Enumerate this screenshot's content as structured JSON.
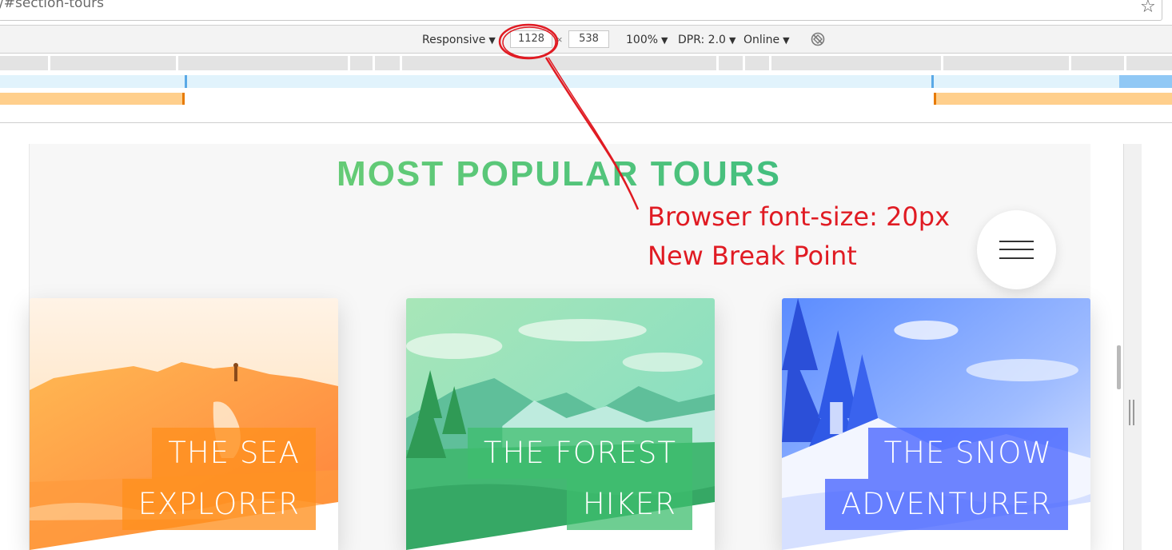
{
  "address_bar": {
    "url_text": "/#section-tours",
    "star_icon": "star-outline-icon"
  },
  "device_toolbar": {
    "device_mode": "Responsive",
    "width": "1128",
    "times": "×",
    "height": "538",
    "zoom": "100%",
    "dpr": "DPR: 2.0",
    "network": "Online",
    "caret": "▼",
    "rotate_icon": "rotate-icon"
  },
  "page": {
    "section_heading": "MOST POPULAR TOURS",
    "heading_colors": [
      "#7ed56f",
      "#55c57a",
      "#28b485"
    ],
    "nav_icon": "hamburger-menu-icon",
    "cards": [
      {
        "title_line_1": "THE SEA",
        "title_line_2": "EXPLORER",
        "color": "#ff8f1e",
        "image": "coastal rock arch landscape"
      },
      {
        "title_line_1": "THE FOREST",
        "title_line_2": "HIKER",
        "color": "#3dbe6e",
        "image": "mountain forest valley"
      },
      {
        "title_line_1": "THE SNOW",
        "title_line_2": "ADVENTURER",
        "color": "#4664ff",
        "image": "snowy trees and hiker"
      }
    ]
  },
  "annotation": {
    "line_1": "Browser font-size: 20px",
    "line_2": "New Break Point",
    "color": "#e01b23"
  }
}
